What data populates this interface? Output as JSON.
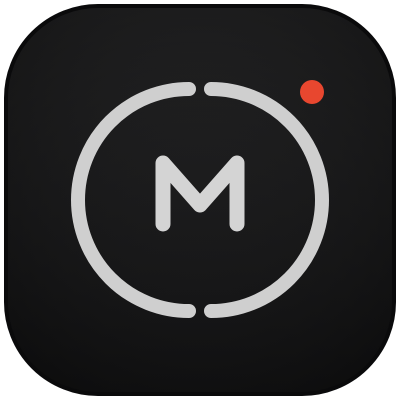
{
  "icon": {
    "name": "app-icon-m-monogram",
    "monogram_letter": "M",
    "colors": {
      "tile_dark": "#19191a",
      "tile_edge": "#0b0b0c",
      "ring": "#cfcfcf",
      "letter": "#d4d4d4",
      "notification_dot": "#e8472f"
    }
  }
}
